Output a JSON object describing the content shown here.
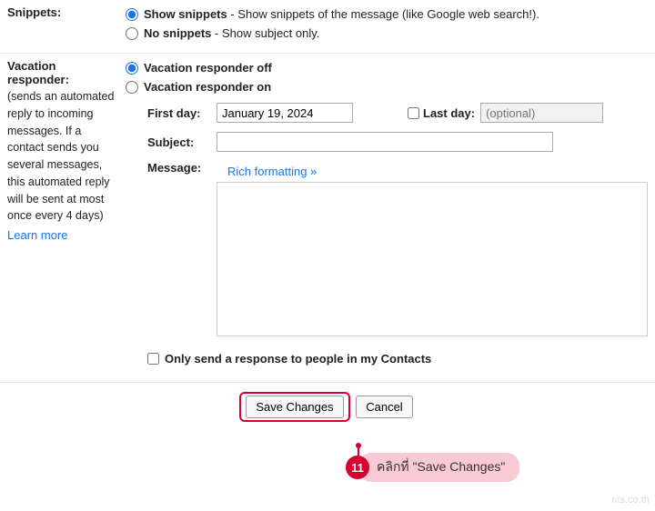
{
  "snippets": {
    "section_label": "Snippets:",
    "show": {
      "title": "Show snippets",
      "desc": " - Show snippets of the message (like Google web search!)."
    },
    "no": {
      "title": "No snippets",
      "desc": " - Show subject only."
    }
  },
  "vacation": {
    "section_label": "Vacation responder:",
    "help_text": "(sends an automated reply to incoming messages. If a contact sends you several messages, this automated reply will be sent at most once every 4 days)",
    "learn_more": "Learn more",
    "off_label": "Vacation responder off",
    "on_label": "Vacation responder on",
    "first_day_label": "First day:",
    "first_day_value": "January 19, 2024",
    "last_day_label": "Last day:",
    "last_day_placeholder": "(optional)",
    "subject_label": "Subject:",
    "subject_value": "",
    "message_label": "Message:",
    "rich_formatting": "Rich formatting »",
    "message_value": "",
    "contacts_only_label": "Only send a response to people in my Contacts"
  },
  "buttons": {
    "save": "Save Changes",
    "cancel": "Cancel"
  },
  "annotation": {
    "number": "11",
    "text": "คลิกที่ \"Save Changes\""
  },
  "watermark": "nts.co.th"
}
